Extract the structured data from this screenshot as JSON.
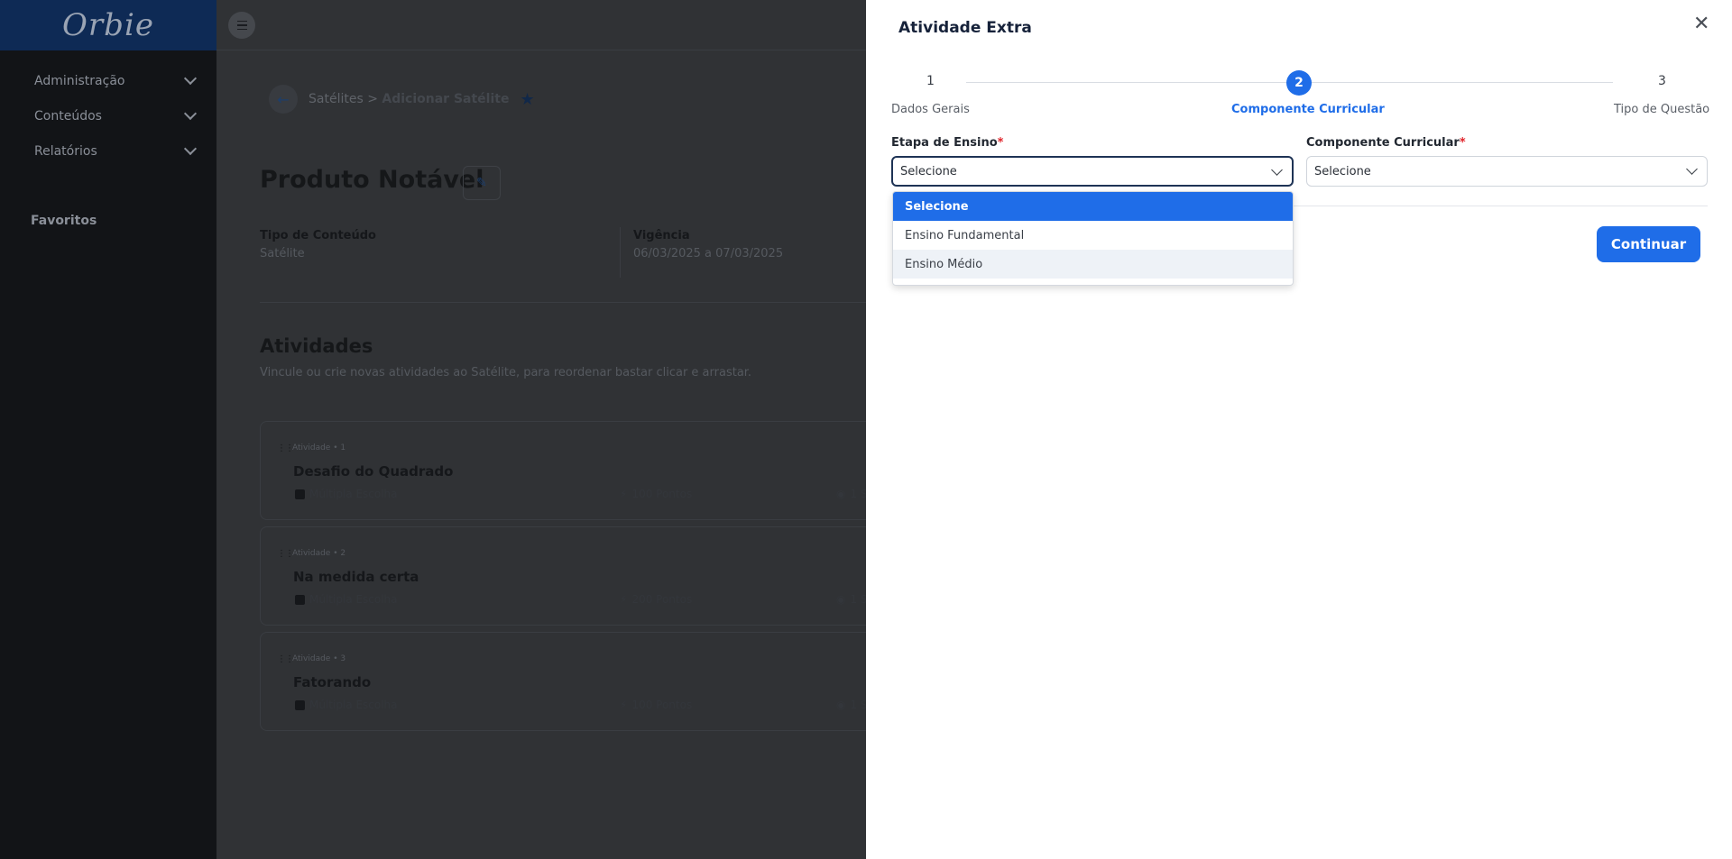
{
  "app": {
    "logo": "Orbie"
  },
  "sidebar": {
    "items": [
      {
        "label": "Administração"
      },
      {
        "label": "Conteúdos"
      },
      {
        "label": "Relatórios"
      }
    ],
    "favorites_title": "Favoritos"
  },
  "breadcrumb": {
    "parent": "Satélites",
    "separator": ">",
    "current": "Adicionar Satélite"
  },
  "page": {
    "title": "Produto Notável",
    "meta": [
      {
        "key": "Tipo de Conteúdo",
        "value": "Satélite"
      },
      {
        "key": "Vigência",
        "value": "06/03/2025 a 07/03/2025"
      }
    ],
    "activities_title": "Atividades",
    "activities_subtitle": "Vincule ou crie novas atividades ao Satélite, para reordenar bastar clicar e arrastar."
  },
  "activities": [
    {
      "label": "Atividade • 1",
      "title": "Desafio do Quadrado",
      "type": "Múltipla Escolha",
      "points": "100 Pontos",
      "extra": "1 Si"
    },
    {
      "label": "Atividade • 2",
      "title": "Na medida certa",
      "type": "Múltipla Escolha",
      "points": "200 Pontos",
      "extra": "1 Si"
    },
    {
      "label": "Atividade • 3",
      "title": "Fatorando",
      "type": "Múltipla Escolha",
      "points": "100 Pontos",
      "extra": "1 Si"
    }
  ],
  "drawer": {
    "title": "Atividade Extra",
    "steps": [
      {
        "number": "1",
        "label": "Dados Gerais"
      },
      {
        "number": "2",
        "label": "Componente Curricular"
      },
      {
        "number": "3",
        "label": "Tipo de Questão"
      }
    ],
    "active_step": 2,
    "fields": {
      "etapa": {
        "label": "Etapa de Ensino",
        "required_mark": "*",
        "value": "Selecione"
      },
      "componente": {
        "label": "Componente Curricular",
        "required_mark": "*",
        "value": "Selecione"
      }
    },
    "dropdown_options": [
      "Selecione",
      "Ensino Fundamental",
      "Ensino Médio"
    ],
    "continue_label": "Continuar"
  },
  "colors": {
    "accent": "#1f6de8",
    "sidebar_bg": "#121417",
    "logo_bar": "#0e2a55",
    "required": "#e0242b"
  }
}
